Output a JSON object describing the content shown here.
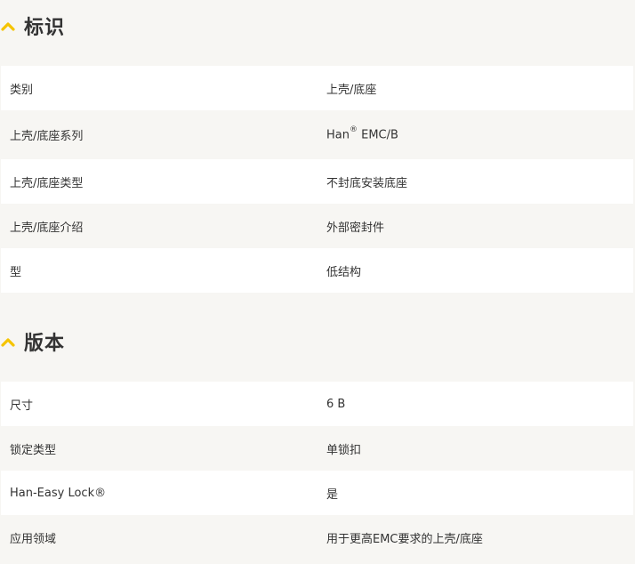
{
  "colors": {
    "accent": "#f5c400",
    "background": "#f7f6f3",
    "row_odd": "#ffffff",
    "row_even": "#f7f6f3",
    "text": "#333333"
  },
  "sections": [
    {
      "title": "标识",
      "icon": "chevron-up-icon",
      "rows": [
        {
          "key": "类别",
          "value": "上壳/底座"
        },
        {
          "key": "上壳/底座系列",
          "value": "Han",
          "value_sup": "®",
          "value_suffix": " EMC/B"
        },
        {
          "key": "上壳/底座类型",
          "value": "不封底安装底座"
        },
        {
          "key": "上壳/底座介绍",
          "value": "外部密封件"
        },
        {
          "key": "型",
          "value": "低结构"
        }
      ]
    },
    {
      "title": "版本",
      "icon": "chevron-up-icon",
      "rows": [
        {
          "key": "尺寸",
          "value": "6 B"
        },
        {
          "key": "锁定类型",
          "value": "单锁扣"
        },
        {
          "key": "Han-Easy Lock®",
          "value": "是"
        },
        {
          "key": "应用领域",
          "value": "用于更高EMC要求的上壳/底座"
        }
      ]
    }
  ]
}
